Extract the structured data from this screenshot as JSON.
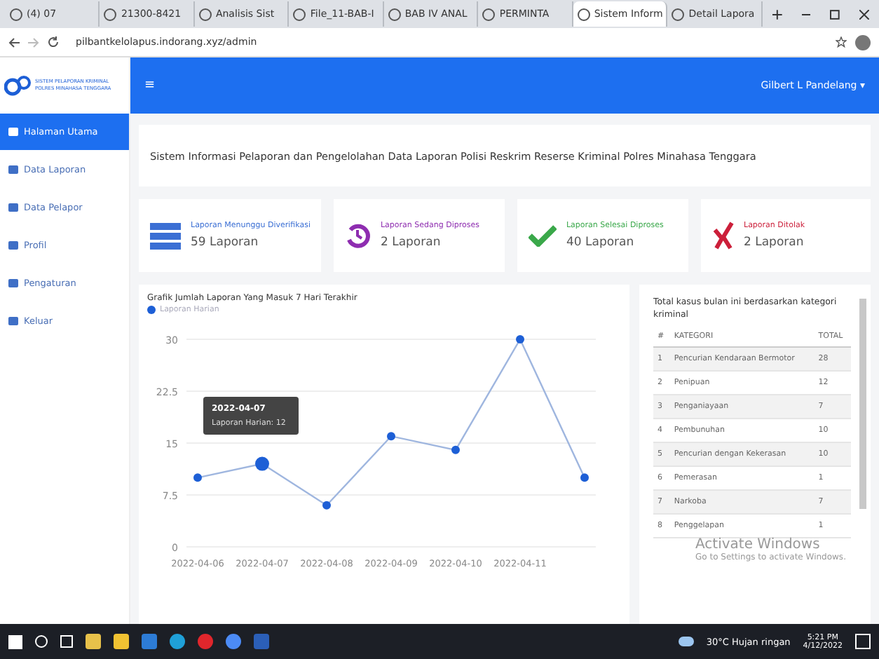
{
  "browser": {
    "tabs": [
      {
        "title": "(4) 07",
        "selected": false
      },
      {
        "title": "21300-8421",
        "selected": false
      },
      {
        "title": "Analisis Sist",
        "selected": false
      },
      {
        "title": "File_11-BAB-I",
        "selected": false
      },
      {
        "title": "BAB IV ANAL",
        "selected": false
      },
      {
        "title": "PERMINTA",
        "selected": false
      },
      {
        "title": "Sistem Inform",
        "selected": true
      },
      {
        "title": "Detail Lapora",
        "selected": false
      }
    ],
    "url": "pilbantkelolapus.indorang.xyz/admin"
  },
  "logo": {
    "line_1": "SISTEM PELAPORAN KRIMINAL",
    "line_2": "POLRES MINAHASA TENGGARA"
  },
  "header": {
    "menu_icon": "≡",
    "user": "Gilbert L Pandelang ▾"
  },
  "sidebar": {
    "items": [
      {
        "label": "Halaman Utama",
        "selected": true
      },
      {
        "label": "Data Laporan",
        "selected": false
      },
      {
        "label": "Data Pelapor",
        "selected": false
      },
      {
        "label": "Profil",
        "selected": false
      },
      {
        "label": "Pengaturan",
        "selected": false
      },
      {
        "label": "Keluar",
        "selected": false
      }
    ]
  },
  "page_title": "Sistem Informasi Pelaporan dan Pengelolahan Data Laporan Polisi Reskrim Reserse Kriminal Polres Minahasa Tenggara",
  "stats": [
    {
      "kind": "waiting",
      "label": "Laporan Menunggu Diverifikasi",
      "value": "59 Laporan",
      "color": "#3b6fd4"
    },
    {
      "kind": "process",
      "label": "Laporan Sedang Diproses",
      "value": "2 Laporan",
      "color": "#8e2db0"
    },
    {
      "kind": "done",
      "label": "Laporan Selesai Diproses",
      "value": "40 Laporan",
      "color": "#3aa84a"
    },
    {
      "kind": "rejected",
      "label": "Laporan Ditolak",
      "value": "2 Laporan",
      "color": "#cc1f3a"
    }
  ],
  "chart": {
    "title": "Grafik Jumlah Laporan Yang Masuk 7 Hari Terakhir",
    "tooltip": {
      "title": "2022-04-07",
      "text": "Laporan Harian: 12"
    },
    "chart_data": {
      "type": "line",
      "categories": [
        "2022-04-06",
        "2022-04-07",
        "2022-04-08",
        "2022-04-09",
        "2022-04-10",
        "2022-04-11",
        null
      ],
      "series": [
        {
          "name": "Laporan Harian",
          "color": "#1d5fd6",
          "marker": true,
          "values": [
            10,
            12,
            6,
            16,
            14,
            30,
            10
          ]
        }
      ],
      "grid": true,
      "ylim": [
        0,
        30
      ],
      "yticks": [
        {
          "value": 0,
          "label": "0"
        },
        {
          "value": 7.5,
          "label": "7.5"
        },
        {
          "value": 15,
          "label": "15"
        },
        {
          "value": 22.5,
          "label": "22.5"
        },
        {
          "value": 30,
          "label": "30"
        }
      ]
    }
  },
  "table": {
    "title": "Total kasus bulan ini berdasarkan kategori kriminal",
    "columns": [
      "#",
      "KATEGORI",
      "TOTAL"
    ],
    "rows": [
      [
        "1",
        "Pencurian Kendaraan Bermotor",
        "28"
      ],
      [
        "2",
        "Penipuan",
        "12"
      ],
      [
        "3",
        "Penganiayaan",
        "7"
      ],
      [
        "4",
        "Pembunuhan",
        "10"
      ],
      [
        "5",
        "Pencurian dengan Kekerasan",
        "10"
      ],
      [
        "6",
        "Pemerasan",
        "1"
      ],
      [
        "7",
        "Narkoba",
        "7"
      ],
      [
        "8",
        "Penggelapan",
        "1"
      ]
    ]
  },
  "activation": {
    "title": "Activate Windows",
    "text": "Go to Settings to activate Windows."
  },
  "taskbar": {
    "weather": "30°C Hujan ringan",
    "time": "5:21 PM",
    "date": "4/12/2022"
  }
}
